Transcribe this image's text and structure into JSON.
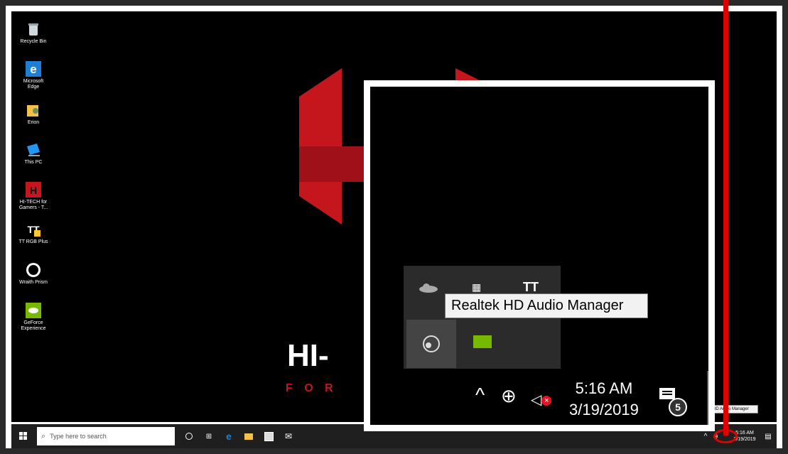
{
  "desktop": {
    "icons": [
      {
        "label": "Recycle Bin",
        "icon": "recycle-bin-icon"
      },
      {
        "label": "Microsoft Edge",
        "icon": "edge-icon"
      },
      {
        "label": "Erion",
        "icon": "user-folder-icon"
      },
      {
        "label": "This PC",
        "icon": "computer-icon"
      },
      {
        "label": "HI-TECH for Gamers - T...",
        "icon": "hitech-icon"
      },
      {
        "label": "TT RGB Plus",
        "icon": "tt-rgb-icon"
      },
      {
        "label": "Wraith Prism",
        "icon": "cooler-master-icon"
      },
      {
        "label": "GeForce Experience",
        "icon": "geforce-icon"
      }
    ],
    "wallpaper_text": {
      "logo": "HI-",
      "sub": "F O R"
    }
  },
  "taskbar": {
    "search_placeholder": "Type here to search",
    "clock_time": "5:16 AM",
    "clock_date": "3/19/2019",
    "notification_count": "5",
    "tooltip": "HD Audio Manager"
  },
  "zoom": {
    "tooltip": "Realtek HD Audio Manager",
    "clock_time": "5:16 AM",
    "clock_date": "3/19/2019",
    "notification_count": "5"
  },
  "colors": {
    "accent_red": "#e00000",
    "edge_blue": "#1e7fd6",
    "nvidia_green": "#76b900"
  }
}
